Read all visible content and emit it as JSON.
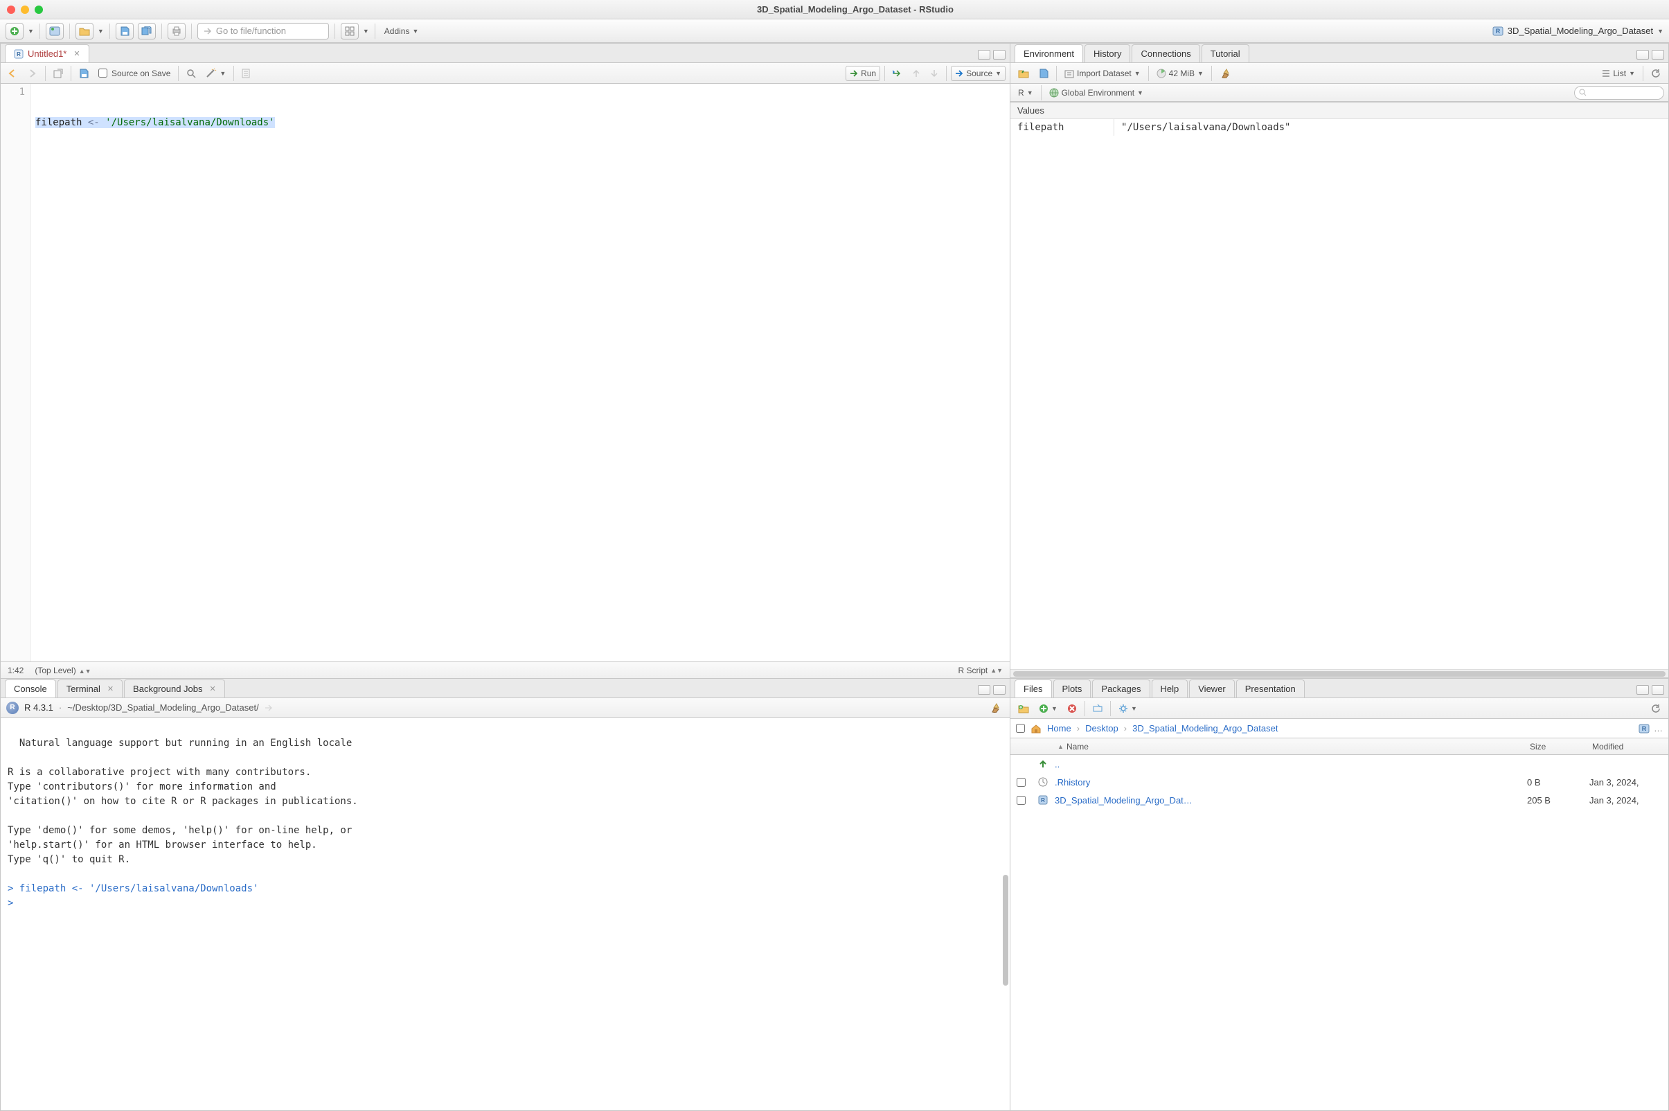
{
  "window": {
    "title": "3D_Spatial_Modeling_Argo_Dataset - RStudio"
  },
  "main_toolbar": {
    "addins": "Addins",
    "goto_placeholder": "Go to file/function",
    "project_name": "3D_Spatial_Modeling_Argo_Dataset"
  },
  "source": {
    "tab_title": "Untitled1*",
    "source_on_save": "Source on Save",
    "run": "Run",
    "source_btn": "Source",
    "cursor": "1:42",
    "scope": "(Top Level)",
    "file_type": "R Script",
    "code": {
      "line1_id": "filepath",
      "line1_op": " <- ",
      "line1_str": "'/Users/laisalvana/Downloads'"
    }
  },
  "console": {
    "tabs": {
      "console": "Console",
      "terminal": "Terminal",
      "bgjobs": "Background Jobs"
    },
    "r_version": "R 4.3.1",
    "wd": "~/Desktop/3D_Spatial_Modeling_Argo_Dataset/",
    "body_plain": "  Natural language support but running in an English locale\n\nR is a collaborative project with many contributors.\nType 'contributors()' for more information and\n'citation()' on how to cite R or R packages in publications.\n\nType 'demo()' for some demos, 'help()' for on-line help, or\n'help.start()' for an HTML browser interface to help.\nType 'q()' to quit R.\n",
    "prompt1": "> filepath <- '/Users/laisalvana/Downloads'",
    "prompt2": "> "
  },
  "env": {
    "tabs": {
      "environment": "Environment",
      "history": "History",
      "connections": "Connections",
      "tutorial": "Tutorial"
    },
    "import": "Import Dataset",
    "mem": "42 MiB",
    "list": "List",
    "lang": "R",
    "scope": "Global Environment",
    "section": "Values",
    "rows": [
      {
        "name": "filepath",
        "value": "\"/Users/laisalvana/Downloads\""
      }
    ]
  },
  "files": {
    "tabs": {
      "files": "Files",
      "plots": "Plots",
      "packages": "Packages",
      "help": "Help",
      "viewer": "Viewer",
      "presentation": "Presentation"
    },
    "crumbs": {
      "home": "Home",
      "desktop": "Desktop",
      "proj": "3D_Spatial_Modeling_Argo_Dataset"
    },
    "columns": {
      "name": "Name",
      "size": "Size",
      "modified": "Modified"
    },
    "updir": "..",
    "rows": [
      {
        "name": ".Rhistory",
        "size": "0 B",
        "modified": "Jan 3, 2024,",
        "icon": "history"
      },
      {
        "name": "3D_Spatial_Modeling_Argo_Dat…",
        "size": "205 B",
        "modified": "Jan 3, 2024,",
        "icon": "rproj"
      }
    ],
    "more": "…"
  }
}
